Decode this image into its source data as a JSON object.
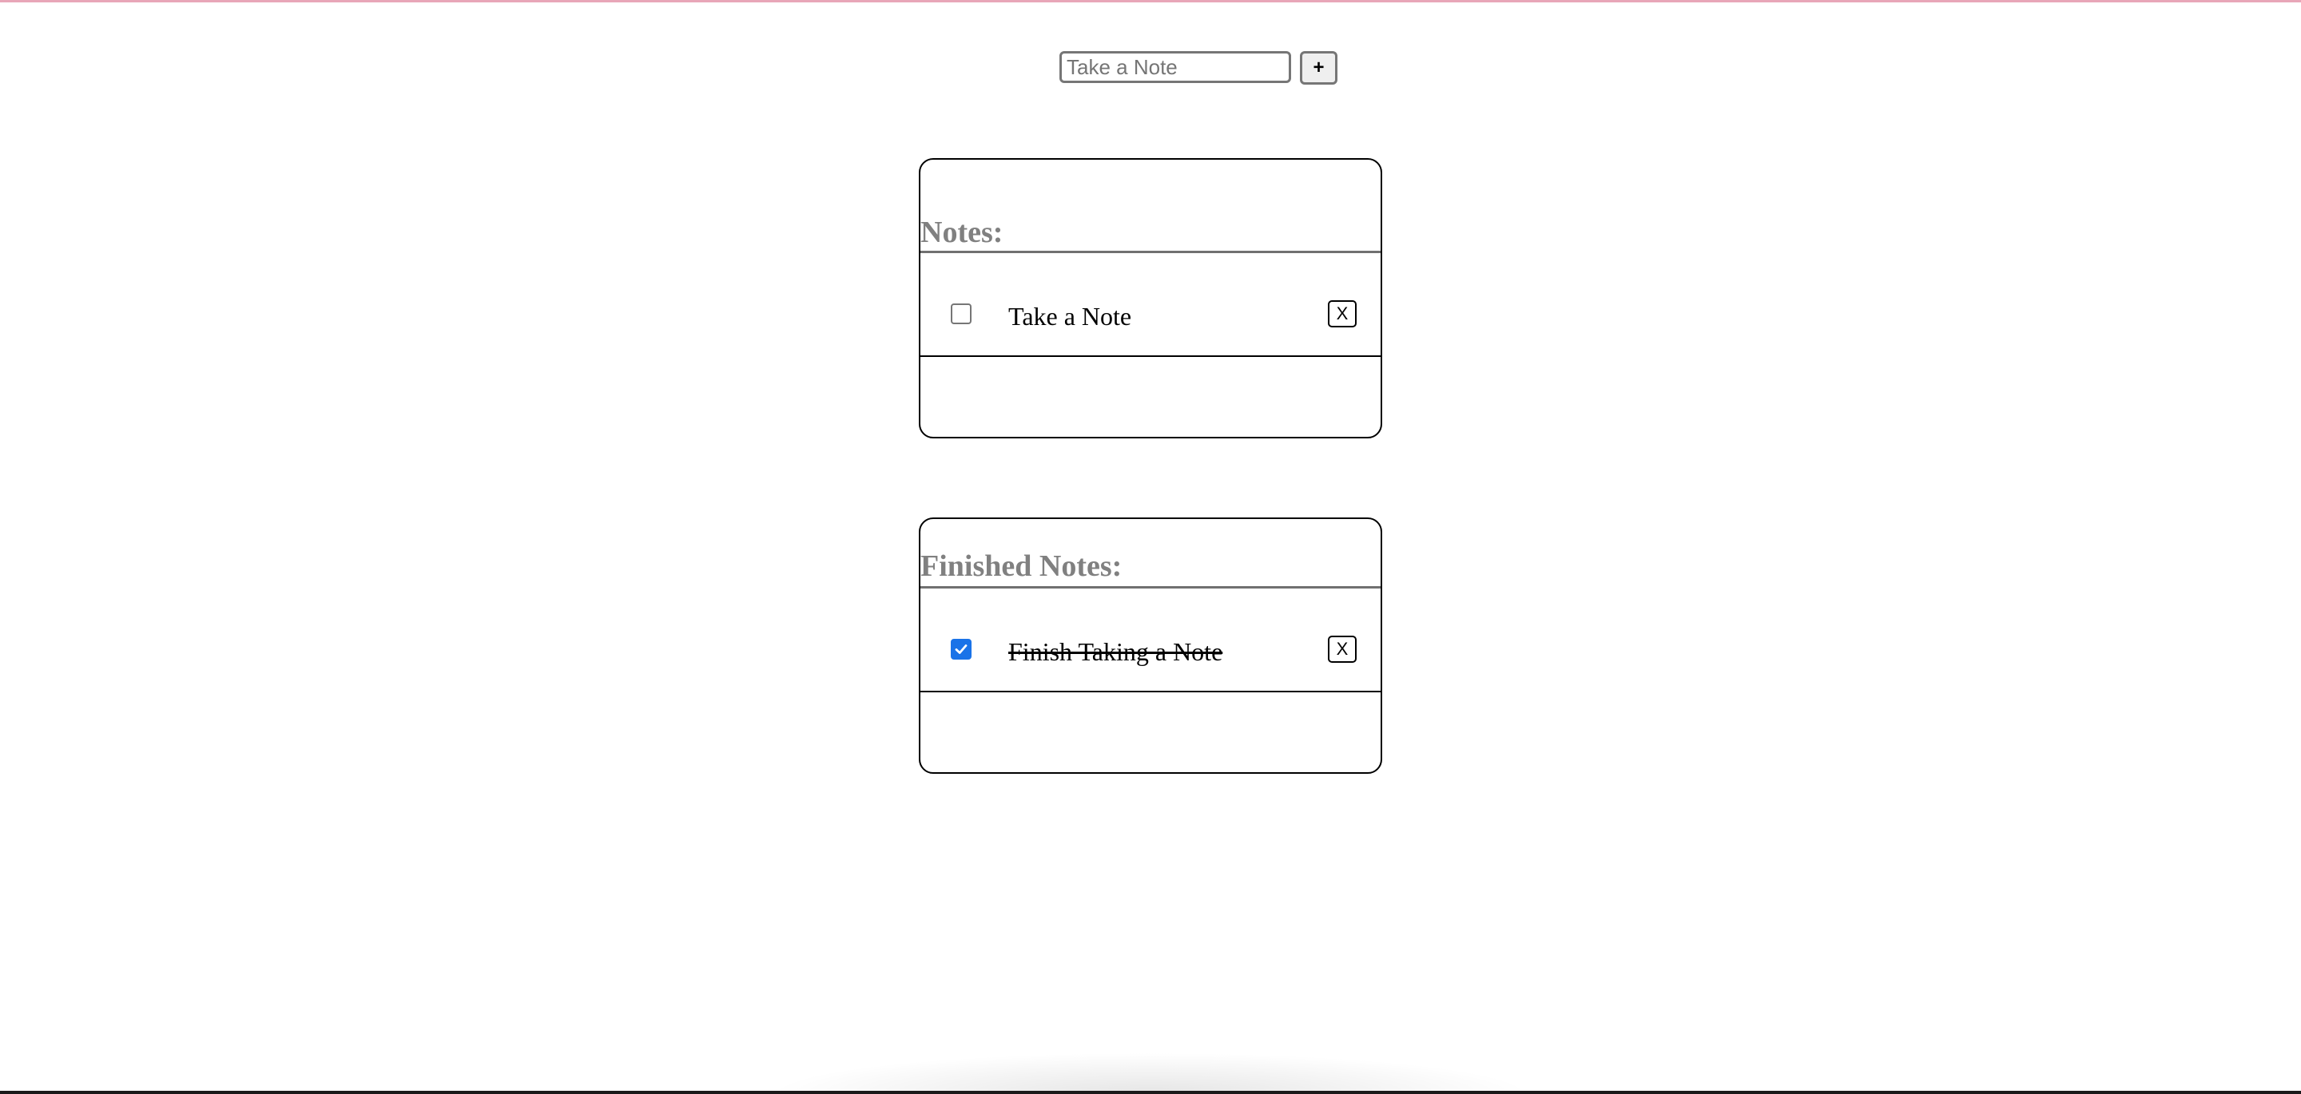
{
  "input": {
    "placeholder": "Take a Note",
    "value": ""
  },
  "add_button_label": "+",
  "notes_section": {
    "title": "Notes:",
    "items": [
      {
        "text": "Take a Note",
        "checked": false,
        "delete_label": "X"
      }
    ]
  },
  "finished_section": {
    "title": "Finished Notes:",
    "items": [
      {
        "text": "Finish Taking a Note",
        "checked": true,
        "delete_label": "X"
      }
    ]
  },
  "colors": {
    "accent": "#1a73e8",
    "title_gray": "#808080",
    "top_border": "#e8a6b8"
  },
  "icons": {
    "checkbox_checked": "checkmark-icon"
  }
}
